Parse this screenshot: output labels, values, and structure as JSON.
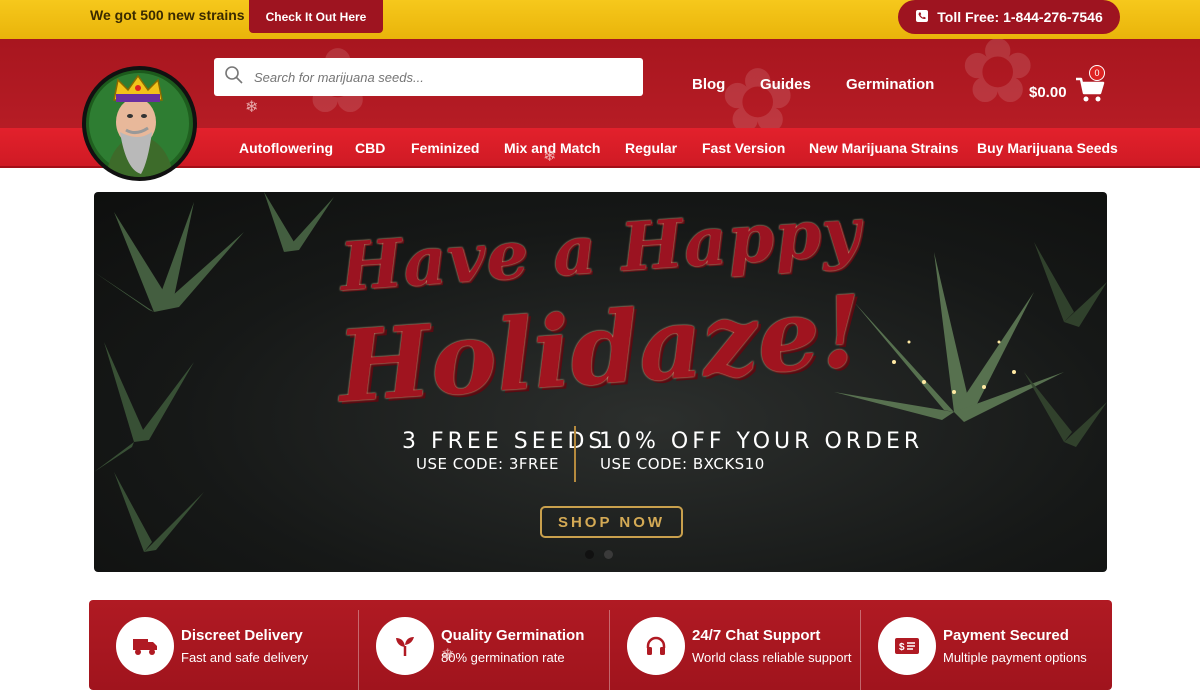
{
  "topbar": {
    "promo_text": "We got 500 new strains",
    "promo_button": "Check It Out Here",
    "tollfree_label": "Toll Free: 1-844-276-7546",
    "phone_icon": "phone-icon"
  },
  "header": {
    "search_placeholder": "Search for marijuana seeds...",
    "nav": [
      "Blog",
      "Guides",
      "Germination"
    ],
    "cart_total": "$0.00",
    "cart_count": "0"
  },
  "categories": [
    "Autoflowering",
    "CBD",
    "Feminized",
    "Mix and Match",
    "Regular",
    "Fast Version",
    "New Marijuana Strains",
    "Buy Marijuana Seeds"
  ],
  "hero": {
    "line1": "Have a Happy",
    "line2": "Holidaze!",
    "offer1_head": "3 FREE SEEDS",
    "offer1_code": "USE CODE: 3FREE",
    "offer2_head": "10% OFF YOUR ORDER",
    "offer2_code": "USE CODE: BXCKS10",
    "cta": "SHOP NOW",
    "slide_count": 2,
    "active_slide": 1
  },
  "features": [
    {
      "title": "Discreet Delivery",
      "subtitle": "Fast and safe delivery",
      "icon": "truck-icon"
    },
    {
      "title": "Quality Germination",
      "subtitle": "80% germination rate",
      "icon": "sprout-icon"
    },
    {
      "title": "24/7 Chat Support",
      "subtitle": "World class reliable support",
      "icon": "headphones-icon"
    },
    {
      "title": "Payment Secured",
      "subtitle": "Multiple payment options",
      "icon": "payment-card-icon"
    }
  ],
  "colors": {
    "topbar_yellow": "#f6c81c",
    "brand_red": "#a8161f",
    "nav_red": "#e3212c",
    "gold": "#c9a04d"
  }
}
